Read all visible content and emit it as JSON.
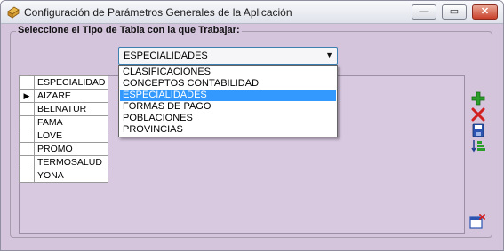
{
  "window": {
    "title": "Configuración de Parámetros Generales de la Aplicación",
    "minimize_glyph": "—",
    "maximize_glyph": "▭",
    "close_glyph": "✕"
  },
  "group": {
    "legend": "Seleccione el Tipo de Tabla con la que Trabajar:"
  },
  "table_type_select": {
    "selected": "ESPECIALIDADES",
    "options": [
      "CLASIFICACIONES",
      "CONCEPTOS CONTABILIDAD",
      "ESPECIALIDADES",
      "FORMAS DE PAGO",
      "POBLACIONES",
      "PROVINCIAS"
    ],
    "highlighted": "ESPECIALIDADES"
  },
  "grid": {
    "header": "ESPECIALIDAD",
    "current_row_marker": "▶",
    "rows": [
      "AIZARE",
      "BELNATUR",
      "FAMA",
      "LOVE",
      "PROMO",
      "TERMOSALUD",
      "YONA"
    ]
  },
  "toolbar": {
    "icons": [
      "add-record-icon",
      "delete-record-icon",
      "save-icon",
      "sort-icon",
      "close-window-icon"
    ],
    "colors": {
      "add": "#2a9d2a",
      "delete": "#d21f1f",
      "save": "#2b55b0"
    }
  }
}
